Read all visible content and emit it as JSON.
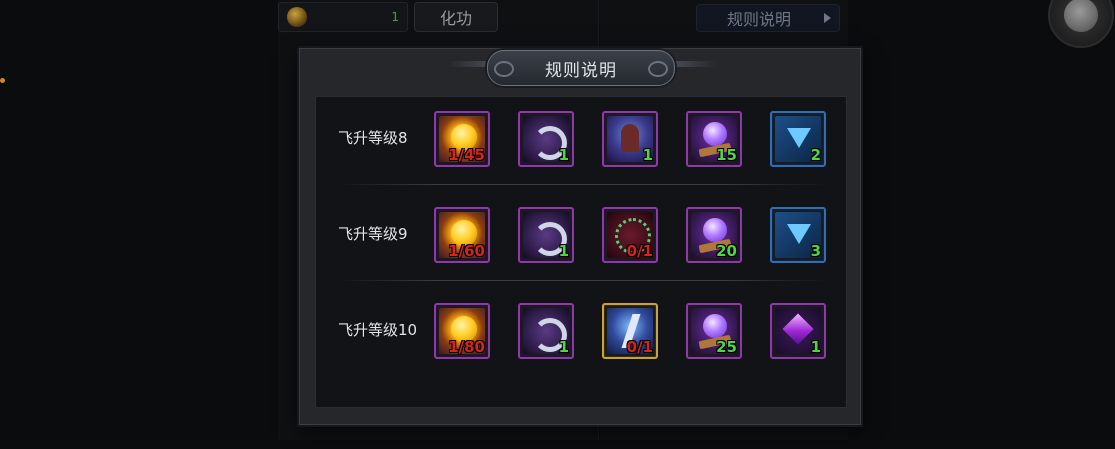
{
  "background": {
    "top_count": "1",
    "huagong_button": "化功",
    "rules_button": "规则说明"
  },
  "dialog": {
    "title": "规则说明",
    "rows": [
      {
        "label": "飞升等级8",
        "items": [
          {
            "icon": "gold-orb-icon",
            "count": "1/45",
            "count_color": "red",
            "frame": "purple"
          },
          {
            "icon": "weapon-icon",
            "count": "1",
            "count_color": "green",
            "frame": "purple"
          },
          {
            "icon": "hooded-figure-icon",
            "count": "1",
            "count_color": "green",
            "frame": "purple"
          },
          {
            "icon": "crystal-ball-icon",
            "count": "15",
            "count_color": "green",
            "frame": "purple"
          },
          {
            "icon": "blue-gem-icon",
            "count": "2",
            "count_color": "green",
            "frame": "blue"
          }
        ]
      },
      {
        "label": "飞升等级9",
        "items": [
          {
            "icon": "gold-orb-icon",
            "count": "1/60",
            "count_color": "red",
            "frame": "purple"
          },
          {
            "icon": "weapon-icon",
            "count": "1",
            "count_color": "green",
            "frame": "purple"
          },
          {
            "icon": "necklace-icon",
            "count": "0/1",
            "count_color": "red",
            "frame": "purple"
          },
          {
            "icon": "crystal-ball-icon",
            "count": "20",
            "count_color": "green",
            "frame": "purple"
          },
          {
            "icon": "blue-gem-icon",
            "count": "3",
            "count_color": "green",
            "frame": "blue"
          }
        ]
      },
      {
        "label": "飞升等级10",
        "items": [
          {
            "icon": "gold-orb-icon",
            "count": "1/80",
            "count_color": "red",
            "frame": "purple"
          },
          {
            "icon": "weapon-icon",
            "count": "1",
            "count_color": "green",
            "frame": "purple"
          },
          {
            "icon": "lightning-icon",
            "count": "0/1",
            "count_color": "red",
            "frame": "gold"
          },
          {
            "icon": "crystal-ball-icon",
            "count": "25",
            "count_color": "green",
            "frame": "purple"
          },
          {
            "icon": "purple-gem-icon",
            "count": "1",
            "count_color": "green",
            "frame": "purple"
          }
        ]
      }
    ]
  },
  "colors": {
    "count_red": "#d8231f",
    "count_green": "#53d34a",
    "frame_purple": "#8b3aa8",
    "frame_blue": "#2e6fb8",
    "frame_gold": "#c9a23a"
  }
}
